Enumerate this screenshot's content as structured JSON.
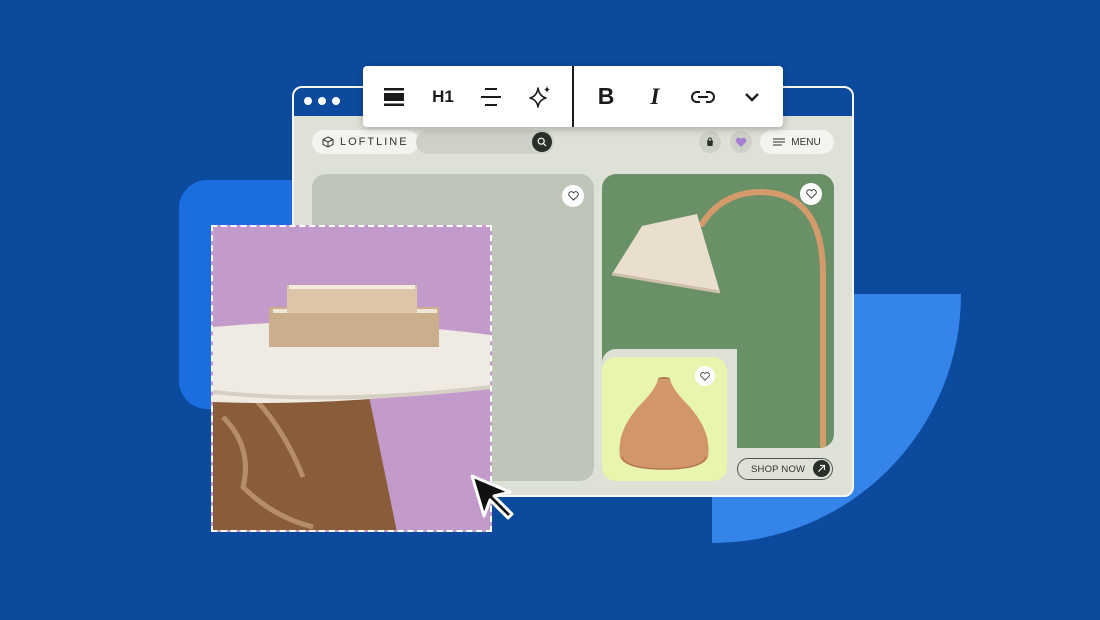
{
  "brand": {
    "name": "LOFTLINE",
    "logo_icon": "cube-icon"
  },
  "editor_toolbar": {
    "tools": [
      {
        "name": "block-tool",
        "icon": "block-icon",
        "label": ""
      },
      {
        "name": "heading-tool",
        "icon": "",
        "label": "H1"
      },
      {
        "name": "align-tool",
        "icon": "align-center-icon",
        "label": ""
      },
      {
        "name": "ai-tool",
        "icon": "sparkle-icon",
        "label": ""
      },
      {
        "name": "bold-tool",
        "icon": "",
        "label": "B"
      },
      {
        "name": "italic-tool",
        "icon": "",
        "label": "I"
      },
      {
        "name": "link-tool",
        "icon": "link-icon",
        "label": ""
      },
      {
        "name": "more-tool",
        "icon": "chevron-down-icon",
        "label": ""
      }
    ]
  },
  "site_nav": {
    "search_placeholder": "",
    "search_icon": "search-icon",
    "cart_icon": "bag-icon",
    "wishlist_icon": "heart-icon",
    "menu_label": "MENU",
    "menu_icon": "hamburger-icon"
  },
  "products": [
    {
      "name": "side-table",
      "image": "marble-table-with-books"
    },
    {
      "name": "floor-lamp",
      "image": "arc-floor-lamp"
    },
    {
      "name": "vase",
      "image": "ceramic-vase"
    }
  ],
  "cta": {
    "label": "SHOP NOW",
    "icon": "arrow-up-right-icon"
  },
  "colors": {
    "background": "#0c4a9e",
    "accent_blue": "#1c6de0",
    "light_blue": "#3584ea",
    "lamp_card": "#6a9068",
    "vase_card": "#e8f5ac",
    "selection_bg": "#c39bca",
    "heart_accent": "#a67fd0"
  }
}
